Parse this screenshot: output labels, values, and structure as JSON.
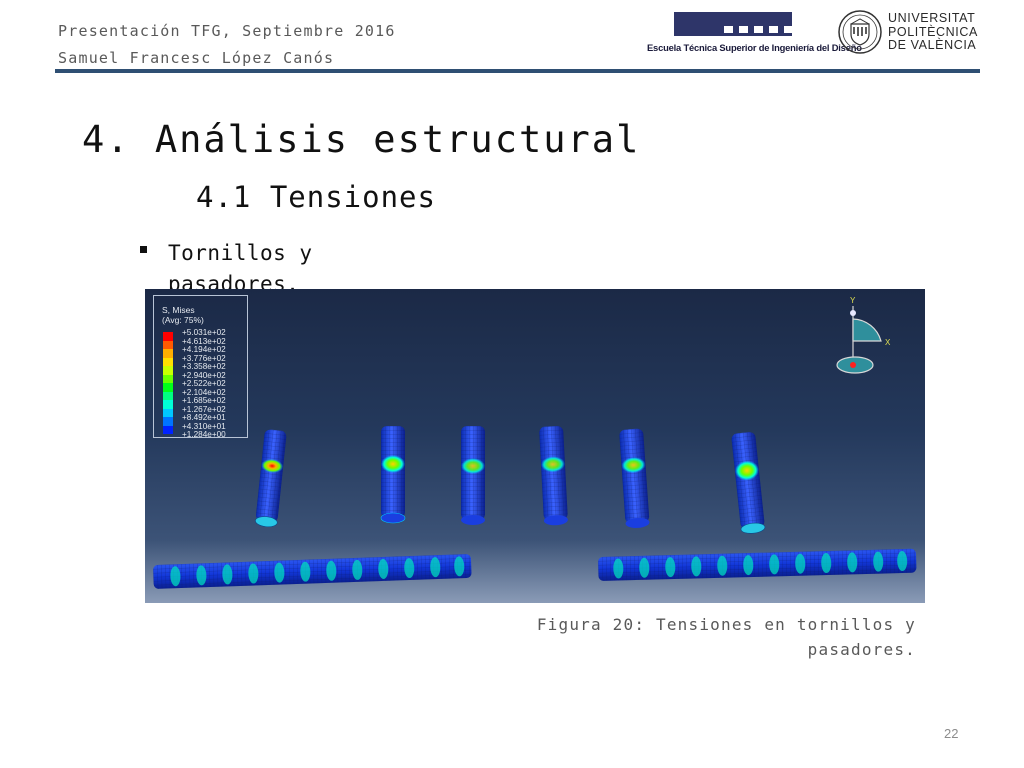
{
  "header": {
    "line1": "Presentación TFG, Septiembre 2016",
    "line2": "Samuel Francesc López Canós"
  },
  "logos": {
    "etsid_text": "Escuela Técnica Superior de Ingeniería del Diseño",
    "upv_line1": "UNIVERSITAT",
    "upv_line2": "POLITÈCNICA",
    "upv_line3": "DE VALÈNCIA"
  },
  "slide": {
    "title": "4. Análisis estructural",
    "subtitle": "4.1 Tensiones",
    "bullet": "Tornillos y pasadores."
  },
  "figure": {
    "legend_title_1": "S, Mises",
    "legend_title_2": "(Avg: 75%)",
    "legend_values": [
      "+5.031e+02",
      "+4.613e+02",
      "+4.194e+02",
      "+3.776e+02",
      "+3.358e+02",
      "+2.940e+02",
      "+2.522e+02",
      "+2.104e+02",
      "+1.685e+02",
      "+1.267e+02",
      "+8.492e+01",
      "+4.310e+01",
      "+1.284e+00"
    ],
    "legend_colors": [
      "#ff0000",
      "#ff5a00",
      "#ffae00",
      "#ffe000",
      "#c8ff00",
      "#6aff00",
      "#00ff1a",
      "#00ff82",
      "#00ffd8",
      "#00c8ff",
      "#0074ff",
      "#0022ff"
    ],
    "triad_y": "Y",
    "triad_x": "X",
    "caption": "Figura 20: Tensiones en tornillos y pasadores."
  },
  "page_number": "22"
}
